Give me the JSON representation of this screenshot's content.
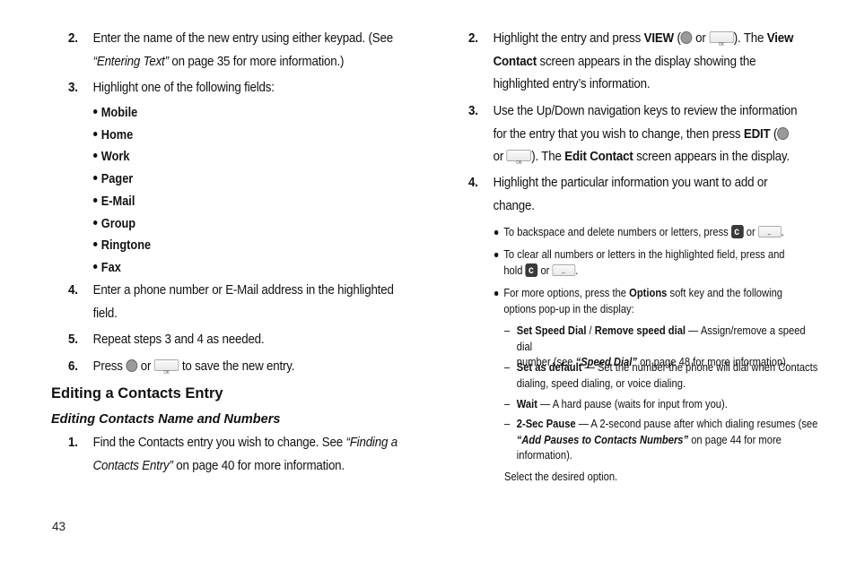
{
  "left": {
    "steps_top": [
      {
        "num": "2.",
        "line1": "Enter the name of the new entry using either keypad. (See",
        "ref": "“Entering Text”",
        "line2_rest": " on page 35 for more information.)"
      },
      {
        "num": "3.",
        "text": "Highlight one of the following fields:"
      }
    ],
    "fields": [
      "Mobile",
      "Home",
      "Work",
      "Pager",
      "E-Mail",
      "Group",
      "Ringtone",
      "Fax"
    ],
    "steps_bottom": [
      {
        "num": "4.",
        "line1": "Enter a phone number or E-Mail address in the highlighted",
        "line2": "field."
      },
      {
        "num": "5.",
        "text": "Repeat steps 3 and 4 as needed."
      },
      {
        "num": "6.",
        "pre": "Press ",
        "or": " or ",
        "post": " to save the new entry."
      }
    ],
    "section_heading": "Editing a Contacts Entry",
    "subsection_heading": "Editing Contacts Name and Numbers",
    "step1": {
      "num": "1.",
      "pre": "Find the Contacts entry you wish to change. See ",
      "ref1": "“Finding a",
      "ref2": "Contacts Entry”",
      "post": " on page 40 for more information."
    }
  },
  "right": {
    "step2": {
      "num": "2.",
      "pre": "Highlight the entry and press ",
      "key": "VIEW",
      "open": " (",
      "or": " or ",
      "close": "). The ",
      "screen1": "View",
      "screen2": "Contact",
      "rest1": " screen appears in the display showing the",
      "line3": "highlighted entry’s information."
    },
    "step3": {
      "num": "3.",
      "line1": "Use the Up/Down navigation keys to review the information",
      "pre2": "for the entry that you wish to change, then press ",
      "key": "EDIT",
      "open": " (",
      "or": "or ",
      "close": "). The ",
      "screen": "Edit Contact",
      "rest": " screen appears in the display."
    },
    "step4": {
      "num": "4.",
      "line1": "Highlight the particular information you want to add or",
      "line2": "change."
    },
    "bullets": {
      "backspace": {
        "pre": "To backspace and delete numbers or letters, press ",
        "or": " or ",
        "post": "."
      },
      "clear": {
        "line1": "To clear all numbers or letters in the highlighted field, press and",
        "pre2": "hold ",
        "or": " or ",
        "post": "."
      },
      "options": {
        "pre": "For more options, press the ",
        "key": "Options",
        "post": " soft key and the following",
        "line2": "options pop-up in the display:"
      }
    },
    "options": [
      {
        "label": "Set Speed Dial",
        "sep": " / ",
        "label2": "Remove speed dial",
        "desc1": " — Assign/remove a speed dial",
        "desc2_pre": "number (see ",
        "ref": "“Speed Dial”",
        "desc2_post": " on page 48 for more information)."
      },
      {
        "label": "Set as default",
        "desc1": " — Set the number the phone will dial when Contacts",
        "desc2": "dialing, speed dialing, or voice dialing."
      },
      {
        "label": "Wait",
        "desc1": " — A hard pause (waits for input from you)."
      },
      {
        "label": "2-Sec Pause",
        "desc1": " — A 2-second pause after which dialing resumes (see",
        "ref": "“Add Pauses to Contacts Numbers”",
        "desc2_post": " on page 44 for more",
        "desc3": "information)."
      }
    ],
    "select_text": "Select the desired option."
  },
  "icons": {
    "soft_key": "circle-key-icon",
    "ok_key": "ok-key-icon",
    "clear_key": "clear-key-icon",
    "back_key": "backspace-key-icon"
  },
  "page_number": "43"
}
